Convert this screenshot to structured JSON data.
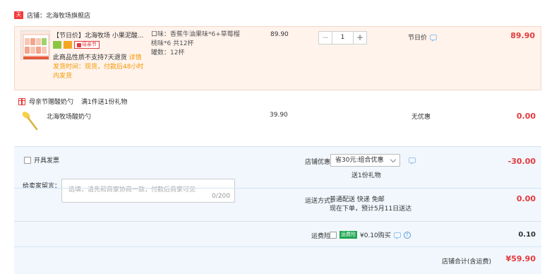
{
  "store": {
    "badge": "天猫",
    "label": "店铺：北海牧场旗舰店"
  },
  "item1": {
    "title": "【节日价】北海牧场 小果泥酸...",
    "tag_mother": "母亲节",
    "note_line1": "此商品性质不支持7天退货",
    "note_detail": "详情",
    "note_line2": "发货时间：现货，付款后48小时内发货",
    "props_line1": "口味：香蕉牛油果味*6+草莓榴",
    "props_line2": "桃味*6 共12杯",
    "props_line3": "罐数：12杯",
    "unit_price": "89.90",
    "qty_minus": "−",
    "qty_value": "1",
    "qty_plus": "+",
    "promo": "节日价",
    "total": "89.90"
  },
  "gift": {
    "title": "母亲节赠酸奶勺",
    "sub": "满1件送1份礼物",
    "item_title": "北海牧场酸奶勺",
    "unit_price": "39.90",
    "promo": "无优惠",
    "total": "0.00"
  },
  "panel": {
    "invoice_label": "开具发票",
    "message_label": "给卖家留言：",
    "message_placeholder": "选填，请先和商家协商一致，付款后商家可见",
    "message_count": "0/200",
    "discount_label": "店铺优惠：",
    "discount_select": "省30元:组合优惠",
    "discount_gift": "送1份礼物",
    "discount_amount": "-30.00",
    "shipping_label": "运送方式：",
    "shipping_line1": "普通配送 快递 免邮",
    "shipping_line2": "现在下单，预计5月11日送达",
    "shipping_amount": "0.00",
    "insurance_label": "运费险：",
    "insurance_badge": "运费险",
    "insurance_text": "¥0.10购买",
    "insurance_help": "?",
    "insurance_amount": "0.10",
    "sum_label": "店铺合计(含运费)",
    "sum_amount": "¥59.90"
  },
  "colors": {
    "price_red": "#e4393c",
    "accent_orange": "#f39800",
    "panel_bg": "#f1f7fd"
  }
}
